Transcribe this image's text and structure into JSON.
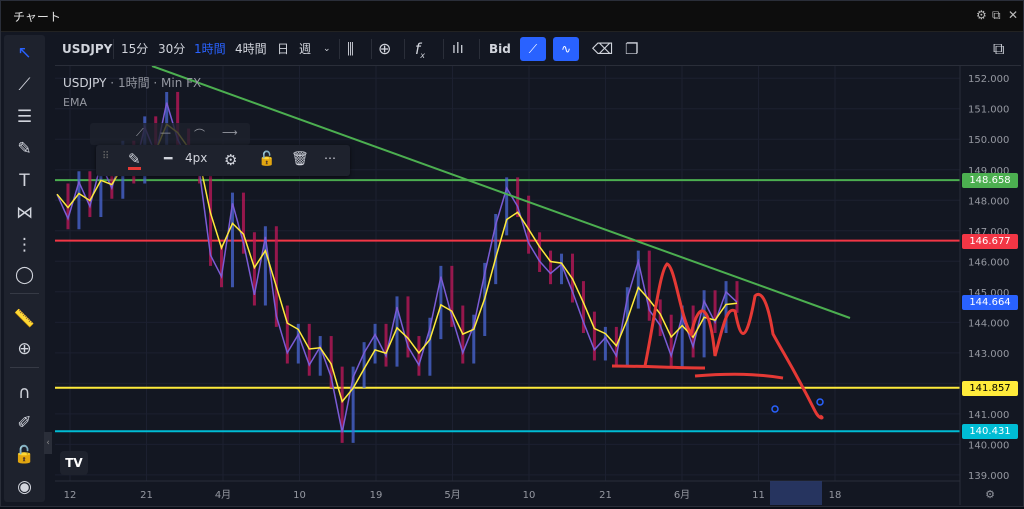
{
  "window": {
    "title": "チャート"
  },
  "toolbar": {
    "symbol": "USDJPY",
    "intervals": [
      "15分",
      "30分",
      "1時間",
      "4時間",
      "日",
      "週"
    ],
    "active_interval": "1時間",
    "fx_label": "f",
    "fx_sub": "x",
    "bid_label": "Bid"
  },
  "legend": {
    "symbol": "USDJPY",
    "interval": "1時間",
    "source": "Min FX",
    "indicator": "EMA"
  },
  "floating_toolbar": {
    "width_label": "4px"
  },
  "colors": {
    "background": "#131722",
    "trend_green": "#4caf50",
    "resistance_green": "#4caf50",
    "red_level": "#f23645",
    "yellow_level": "#ffeb3b",
    "cyan_level": "#00bcd4",
    "current_price": "#2962ff",
    "drawing_red": "#e53935"
  },
  "chart_data": {
    "type": "line",
    "title": "",
    "y_axis_ticks": [
      152.0,
      151.0,
      150.0,
      149.0,
      148.0,
      147.0,
      146.0,
      145.0,
      144.0,
      143.0,
      142.0,
      141.0,
      140.0,
      139.0
    ],
    "y_axis_labels": [
      "152.000",
      "151.000",
      "150.000",
      "149.000",
      "148.000",
      "147.000",
      "146.000",
      "145.000",
      "144.000",
      "143.000",
      "141.000",
      "140.000",
      "139.000"
    ],
    "x_axis_labels": [
      "12",
      "21",
      "4月",
      "10",
      "19",
      "5月",
      "10",
      "21",
      "6月",
      "11",
      "18"
    ],
    "ylim": [
      138.8,
      152.4
    ],
    "horizontal_levels": [
      {
        "value": 148.658,
        "label": "148.658",
        "color": "#4caf50"
      },
      {
        "value": 146.677,
        "label": "146.677",
        "color": "#f23645"
      },
      {
        "value": 141.857,
        "label": "141.857",
        "color": "#ffeb3b"
      },
      {
        "value": 140.431,
        "label": "140.431",
        "color": "#00bcd4"
      }
    ],
    "current_price": {
      "value": 144.664,
      "label": "144.664"
    },
    "price_series": {
      "name": "",
      "points": [
        [
          0,
          148.2
        ],
        [
          1,
          147.4
        ],
        [
          2,
          148.6
        ],
        [
          3,
          147.8
        ],
        [
          4,
          149.2
        ],
        [
          5,
          148.4
        ],
        [
          6,
          149.6
        ],
        [
          7,
          148.9
        ],
        [
          8,
          150.4
        ],
        [
          9,
          149.5
        ],
        [
          10,
          151.2
        ],
        [
          11,
          150.0
        ],
        [
          12,
          149.3
        ],
        [
          13,
          148.9
        ],
        [
          14,
          146.2
        ],
        [
          15,
          145.5
        ],
        [
          16,
          147.9
        ],
        [
          17,
          146.6
        ],
        [
          18,
          144.9
        ],
        [
          19,
          146.8
        ],
        [
          20,
          144.2
        ],
        [
          21,
          143.0
        ],
        [
          22,
          143.6
        ],
        [
          23,
          142.6
        ],
        [
          24,
          143.2
        ],
        [
          25,
          142.2
        ],
        [
          26,
          140.4
        ],
        [
          27,
          142.2
        ],
        [
          28,
          143.0
        ],
        [
          29,
          143.6
        ],
        [
          30,
          142.9
        ],
        [
          31,
          144.5
        ],
        [
          32,
          143.2
        ],
        [
          33,
          142.6
        ],
        [
          34,
          143.8
        ],
        [
          35,
          145.5
        ],
        [
          36,
          144.2
        ],
        [
          37,
          143.0
        ],
        [
          38,
          143.9
        ],
        [
          39,
          145.6
        ],
        [
          40,
          147.2
        ],
        [
          41,
          148.4
        ],
        [
          42,
          147.8
        ],
        [
          43,
          146.6
        ],
        [
          44,
          146.0
        ],
        [
          45,
          145.6
        ],
        [
          46,
          145.9
        ],
        [
          47,
          145.0
        ],
        [
          48,
          144.0
        ],
        [
          49,
          143.1
        ],
        [
          50,
          143.5
        ],
        [
          51,
          142.9
        ],
        [
          52,
          144.8
        ],
        [
          53,
          146.0
        ],
        [
          54,
          144.4
        ],
        [
          55,
          143.9
        ],
        [
          56,
          142.9
        ],
        [
          57,
          144.2
        ],
        [
          58,
          143.2
        ],
        [
          59,
          144.7
        ],
        [
          60,
          144.0
        ],
        [
          61,
          145.0
        ],
        [
          62,
          144.66
        ]
      ]
    },
    "ema_series": {
      "name": "EMA"
    }
  }
}
